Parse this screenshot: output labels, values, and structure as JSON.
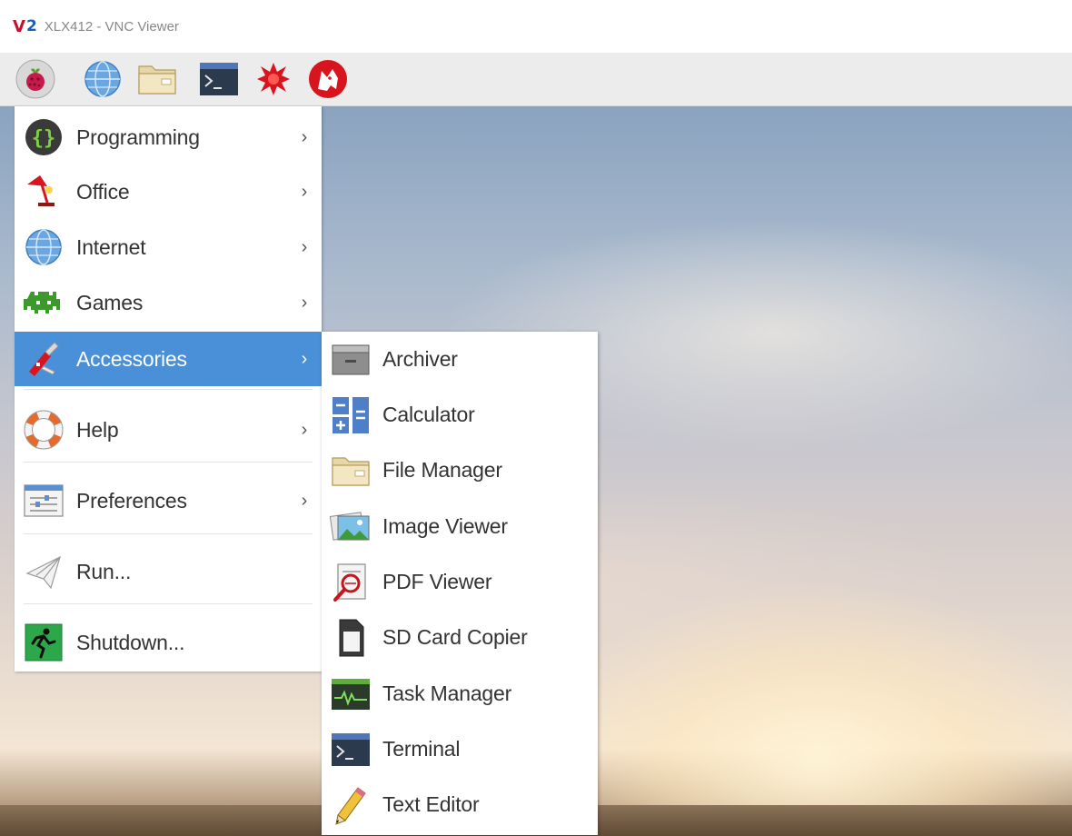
{
  "window": {
    "title": "XLX412 - VNC Viewer",
    "logo": "VNC-viewer-logo-icon"
  },
  "panel": {
    "buttons": [
      {
        "name": "raspberry-menu-button",
        "icon": "raspberry-icon"
      },
      {
        "name": "web-browser-button",
        "icon": "globe-icon"
      },
      {
        "name": "file-manager-button",
        "icon": "folder-icon"
      },
      {
        "name": "terminal-button",
        "icon": "terminal-icon"
      },
      {
        "name": "wolfram-button",
        "icon": "wolfram-star-icon"
      },
      {
        "name": "mathematica-button",
        "icon": "wolf-icon"
      }
    ]
  },
  "menu": {
    "items": [
      {
        "label": "Programming",
        "icon": "braces-icon",
        "submenu": true
      },
      {
        "label": "Office",
        "icon": "desk-lamp-icon",
        "submenu": true
      },
      {
        "label": "Internet",
        "icon": "globe-icon",
        "submenu": true
      },
      {
        "label": "Games",
        "icon": "space-invader-icon",
        "submenu": true
      },
      {
        "label": "Accessories",
        "icon": "swiss-knife-icon",
        "submenu": true,
        "active": true
      },
      {
        "label": "Help",
        "icon": "lifebuoy-icon",
        "submenu": true
      },
      {
        "label": "Preferences",
        "icon": "settings-window-icon",
        "submenu": true
      },
      {
        "label": "Run...",
        "icon": "paper-plane-icon",
        "submenu": false
      },
      {
        "label": "Shutdown...",
        "icon": "running-man-icon",
        "submenu": false
      }
    ],
    "arrow": "›"
  },
  "submenu": {
    "items": [
      {
        "label": "Archiver",
        "icon": "archive-drawer-icon"
      },
      {
        "label": "Calculator",
        "icon": "calculator-icon"
      },
      {
        "label": "File Manager",
        "icon": "folder-icon"
      },
      {
        "label": "Image Viewer",
        "icon": "landscape-picture-icon"
      },
      {
        "label": "PDF Viewer",
        "icon": "pdf-magnifier-icon"
      },
      {
        "label": "SD Card Copier",
        "icon": "sd-card-icon"
      },
      {
        "label": "Task Manager",
        "icon": "monitor-graph-icon"
      },
      {
        "label": "Terminal",
        "icon": "terminal-icon"
      },
      {
        "label": "Text Editor",
        "icon": "pencil-icon"
      }
    ]
  },
  "colors": {
    "menu_highlight": "#4a90d9",
    "panel_background": "#ececec"
  }
}
